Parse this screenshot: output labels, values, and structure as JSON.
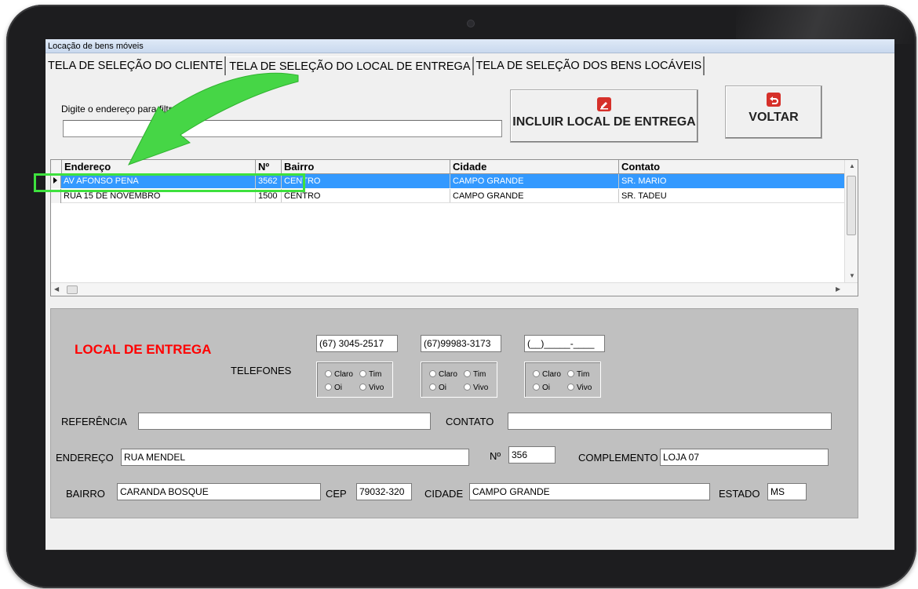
{
  "window": {
    "title": "Locação de bens móveis"
  },
  "tabs": [
    {
      "label": "TELA DE SELEÇÃO DO CLIENTE"
    },
    {
      "label": "TELA DE SELEÇÃO DO LOCAL DE ENTREGA"
    },
    {
      "label": "TELA DE SELEÇÃO DOS BENS LOCÁVEIS"
    }
  ],
  "filter": {
    "label": "Digite o endereço para filtrar",
    "value": ""
  },
  "buttons": {
    "incluir": "INCLUIR LOCAL DE ENTREGA",
    "voltar": "VOLTAR"
  },
  "grid": {
    "columns": [
      "Endereço",
      "Nº",
      "Bairro",
      "Cidade",
      "Contato"
    ],
    "rows": [
      {
        "endereco": "AV AFONSO PENA",
        "numero": "3562",
        "bairro": "CENTRO",
        "cidade": "CAMPO GRANDE",
        "contato": "SR. MARIO"
      },
      {
        "endereco": "RUA 15 DE NOVEMBRO",
        "numero": "1500",
        "bairro": "CENTRO",
        "cidade": "CAMPO GRANDE",
        "contato": "SR. TADEU"
      }
    ]
  },
  "local": {
    "title": "LOCAL DE ENTREGA",
    "telefones_label": "TELEFONES",
    "telefones": [
      "(67) 3045-2517",
      "(67)99983-3173",
      "(__)_____-____"
    ],
    "radio_options": [
      "Claro",
      "Tim",
      "Oi",
      "Vivo"
    ],
    "referencia_label": "REFERÊNCIA",
    "referencia": "",
    "contato_label": "CONTATO",
    "contato": "",
    "endereco_label": "ENDEREÇO",
    "endereco": "RUA MENDEL",
    "numero_label": "Nº",
    "numero": "356",
    "complemento_label": "COMPLEMENTO",
    "complemento": "LOJA 07",
    "bairro_label": "BAIRRO",
    "bairro": "CARANDA BOSQUE",
    "cep_label": "CEP",
    "cep": "79032-320",
    "cidade_label": "CIDADE",
    "cidade": "CAMPO GRANDE",
    "estado_label": "ESTADO",
    "estado": "MS"
  },
  "colors": {
    "accent_red": "#d6302a",
    "title_red": "#ff0000",
    "selection": "#3399ff",
    "highlight_green": "#3ee13e"
  },
  "icons": {
    "incluir": "edit-icon",
    "voltar": "back-arrow-icon",
    "overlay": "green-arrow-icon"
  }
}
